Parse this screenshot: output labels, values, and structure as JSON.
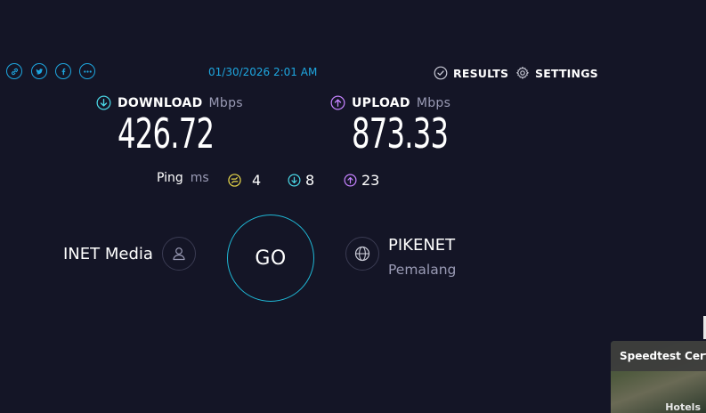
{
  "share": {
    "icons": [
      "link-icon",
      "twitter-icon",
      "facebook-icon",
      "more-icon"
    ]
  },
  "timestamp": "01/30/2026 2:01 AM",
  "nav": {
    "results_label": "RESULTS",
    "settings_label": "SETTINGS"
  },
  "download": {
    "label": "DOWNLOAD",
    "unit": "Mbps",
    "value": "426.72"
  },
  "upload": {
    "label": "UPLOAD",
    "unit": "Mbps",
    "value": "873.33"
  },
  "ping": {
    "label": "Ping",
    "unit": "ms",
    "idle": "4",
    "download": "8",
    "upload": "23"
  },
  "provider": {
    "name": "INET Media"
  },
  "go_label": "GO",
  "server": {
    "name": "PIKENET",
    "location": "Pemalang"
  },
  "ad": {
    "title": "Speedtest Certi",
    "footer": "Hotels"
  },
  "colors": {
    "background": "#141526",
    "accent": "#1ea7e0",
    "download": "#4ad7e6",
    "upload": "#c583ff",
    "idle": "#e9d84a",
    "muted": "#9a9bb5"
  }
}
